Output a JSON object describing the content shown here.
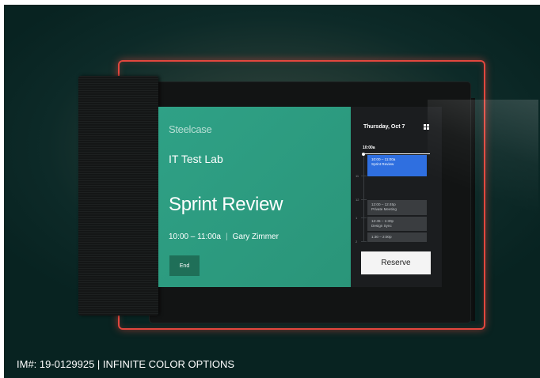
{
  "device": {
    "brand": "Steelcase",
    "room_name": "IT Test Lab",
    "meeting_title": "Sprint Review",
    "meeting_time": "10:00 – 11:00a",
    "separator": "|",
    "organizer": "Gary Zimmer",
    "end_label": "End"
  },
  "schedule": {
    "date": "Thursday, Oct 7",
    "current_time": "10:00a",
    "hour_labels": [
      "11",
      "12",
      "1",
      "2"
    ],
    "events": [
      {
        "time": "10:00 – 11:00a",
        "title": "Sprint Review",
        "active": true
      },
      {
        "time": "12:00 – 12:45p",
        "title": "Private Meeting",
        "active": false
      },
      {
        "time": "12:45 – 1:30p",
        "title": "Design Sync",
        "active": false
      },
      {
        "time": "1:30 – 2:00p",
        "title": "",
        "active": false
      }
    ],
    "reserve_label": "Reserve"
  },
  "caption": "IM#: 19-0129925 | INFINITE COLOR OPTIONS",
  "colors": {
    "accent_green": "#2fa186",
    "active_event": "#2f6fe0",
    "frame_glow": "#e2473e"
  },
  "icons": {
    "grid": "grid-icon"
  }
}
